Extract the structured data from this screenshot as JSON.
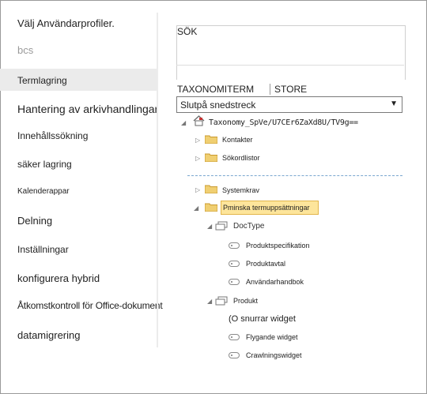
{
  "sidebar": {
    "items": [
      {
        "label": "Välj Användarprofiler."
      },
      {
        "label": "bcs"
      },
      {
        "label": "Termlagring"
      },
      {
        "label": "Hantering av arkivhandlingar"
      },
      {
        "label": "Innehållssökning"
      },
      {
        "label": "säker lagring"
      },
      {
        "label": "Kalenderappar"
      },
      {
        "label": "Delning"
      },
      {
        "label": "Inställningar"
      },
      {
        "label": "konfigurera hybrid"
      },
      {
        "label": "Åtkomstkontroll för Office-dokument"
      },
      {
        "label": "datamigrering"
      }
    ]
  },
  "search": {
    "label": "SÖK"
  },
  "tabs": {
    "taxonomy": "TAXONOMITERM",
    "store": "STORE"
  },
  "dropdown": {
    "value": "Slutpå snedstreck"
  },
  "tree": {
    "root": "Taxonomy_SpVe/U7CEr6ZaXd8U/TV9g==",
    "kontakter": "Kontakter",
    "sokordlistor": "Sökordlistor",
    "systemkrav": "Systemkrav",
    "selected": "Pminska termuppsättningar",
    "doctype": "DocType",
    "produktspec": "Produktspecifikation",
    "produktavtal": "Produktavtal",
    "anvhandbok": "Användarhandbok",
    "produkt": "Produkt",
    "snurrar": "(O snurrar widget",
    "flygande": "Flygande widget",
    "crawlning": "Crawlningswidget"
  },
  "colors": {
    "selection": "#fde59b",
    "sidebar_selected": "#ebebeb",
    "folder": "#e8c25a"
  }
}
